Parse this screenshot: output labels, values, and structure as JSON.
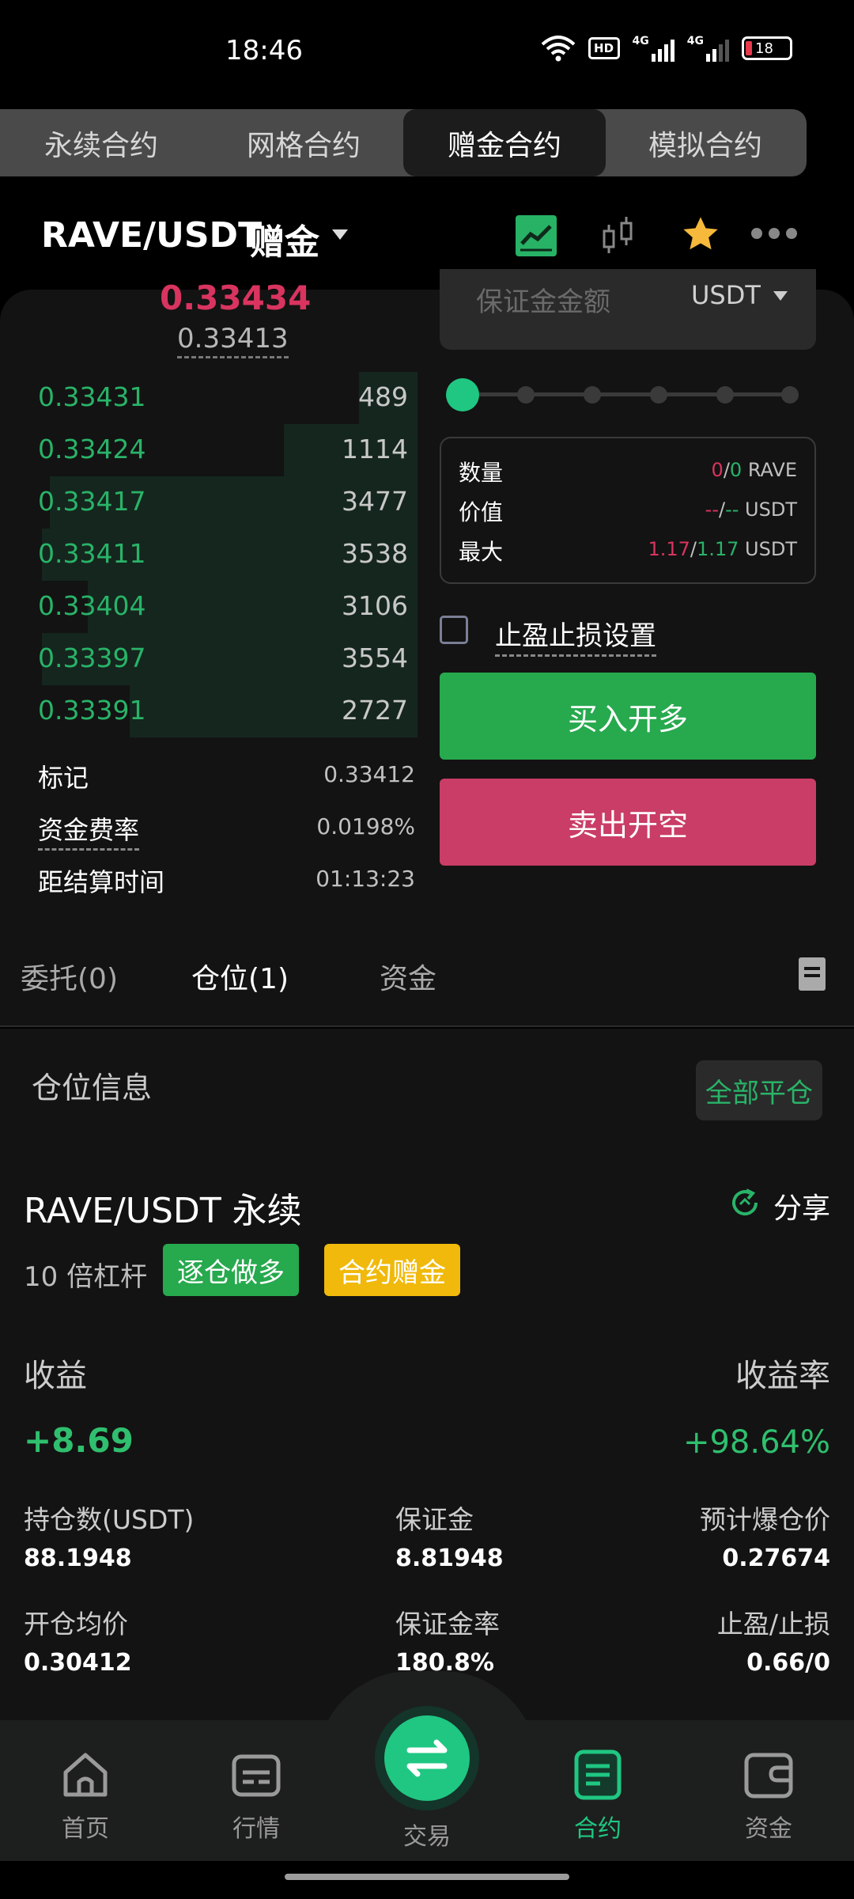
{
  "status_bar": {
    "time": "18:46",
    "battery": "18",
    "network1": "4G",
    "network2": "4G",
    "hd": "HD"
  },
  "top_tabs": [
    {
      "label": "永续合约",
      "active": false
    },
    {
      "label": "网格合约",
      "active": false
    },
    {
      "label": "赠金合约",
      "active": true
    },
    {
      "label": "模拟合约",
      "active": false
    }
  ],
  "header": {
    "pair": "RAVE/USDT",
    "tag": "赠金"
  },
  "orderbook": {
    "last_price": "0.33434",
    "index_price": "0.33413",
    "bids": [
      {
        "price": "0.33431",
        "qty": "489",
        "depth": 0.14
      },
      {
        "price": "0.33424",
        "qty": "1114",
        "depth": 0.32
      },
      {
        "price": "0.33417",
        "qty": "3477",
        "depth": 0.88
      },
      {
        "price": "0.33411",
        "qty": "3538",
        "depth": 0.9
      },
      {
        "price": "0.33404",
        "qty": "3106",
        "depth": 0.79
      },
      {
        "price": "0.33397",
        "qty": "3554",
        "depth": 0.9
      },
      {
        "price": "0.33391",
        "qty": "2727",
        "depth": 0.69
      }
    ]
  },
  "market_info": [
    {
      "label": "标记",
      "value": "0.33412",
      "dashed": false
    },
    {
      "label": "资金费率",
      "value": "0.0198%",
      "dashed": true
    },
    {
      "label": "距结算时间",
      "value": "01:13:23",
      "dashed": false
    }
  ],
  "order_form": {
    "margin_placeholder": "保证金金额",
    "margin_unit": "USDT",
    "slider_percent": 0,
    "quantity_label": "数量",
    "quantity_sell": "0",
    "quantity_buy": "0",
    "quantity_unit": "RAVE",
    "value_label": "价值",
    "value_sell": "--",
    "value_buy": "--",
    "value_unit": "USDT",
    "max_label": "最大",
    "max_sell": "1.17",
    "max_buy": "1.17",
    "max_unit": "USDT",
    "tpsl_label": "止盈止损设置",
    "buy_label": "买入开多",
    "sell_label": "卖出开空"
  },
  "section_tabs": [
    {
      "label": "委托(0)",
      "active": false
    },
    {
      "label": "仓位(1)",
      "active": true
    },
    {
      "label": "资金",
      "active": false
    }
  ],
  "positions": {
    "title": "仓位信息",
    "close_all": "全部平仓",
    "symbol": "RAVE/USDT 永续",
    "share": "分享",
    "leverage": "10 倍杠杆",
    "badge_long": "逐仓做多",
    "badge_bonus": "合约赠金",
    "pnl_label": "收益",
    "pnl_rate_label": "收益率",
    "pnl_value": "+8.69",
    "pnl_rate_value": "+98.64%",
    "stats": [
      {
        "label": "持仓数(USDT)",
        "value": "88.1948"
      },
      {
        "label": "保证金",
        "value": "8.81948"
      },
      {
        "label": "预计爆仓价",
        "value": "0.27674"
      },
      {
        "label": "开仓均价",
        "value": "0.30412"
      },
      {
        "label": "保证金率",
        "value": "180.8%"
      },
      {
        "label": "止盈/止损",
        "value": "0.66/0"
      }
    ]
  },
  "bottom_nav": [
    {
      "label": "首页",
      "icon": "home-icon",
      "active": false
    },
    {
      "label": "行情",
      "icon": "market-icon",
      "active": false
    },
    {
      "label": "交易",
      "icon": "swap-icon",
      "active": false
    },
    {
      "label": "合约",
      "icon": "contract-icon",
      "active": true
    },
    {
      "label": "资金",
      "icon": "wallet-icon",
      "active": false
    }
  ],
  "colors": {
    "green": "#29b368",
    "red": "#d9345f",
    "accent": "#1fc782",
    "yellow": "#f0b90b"
  }
}
